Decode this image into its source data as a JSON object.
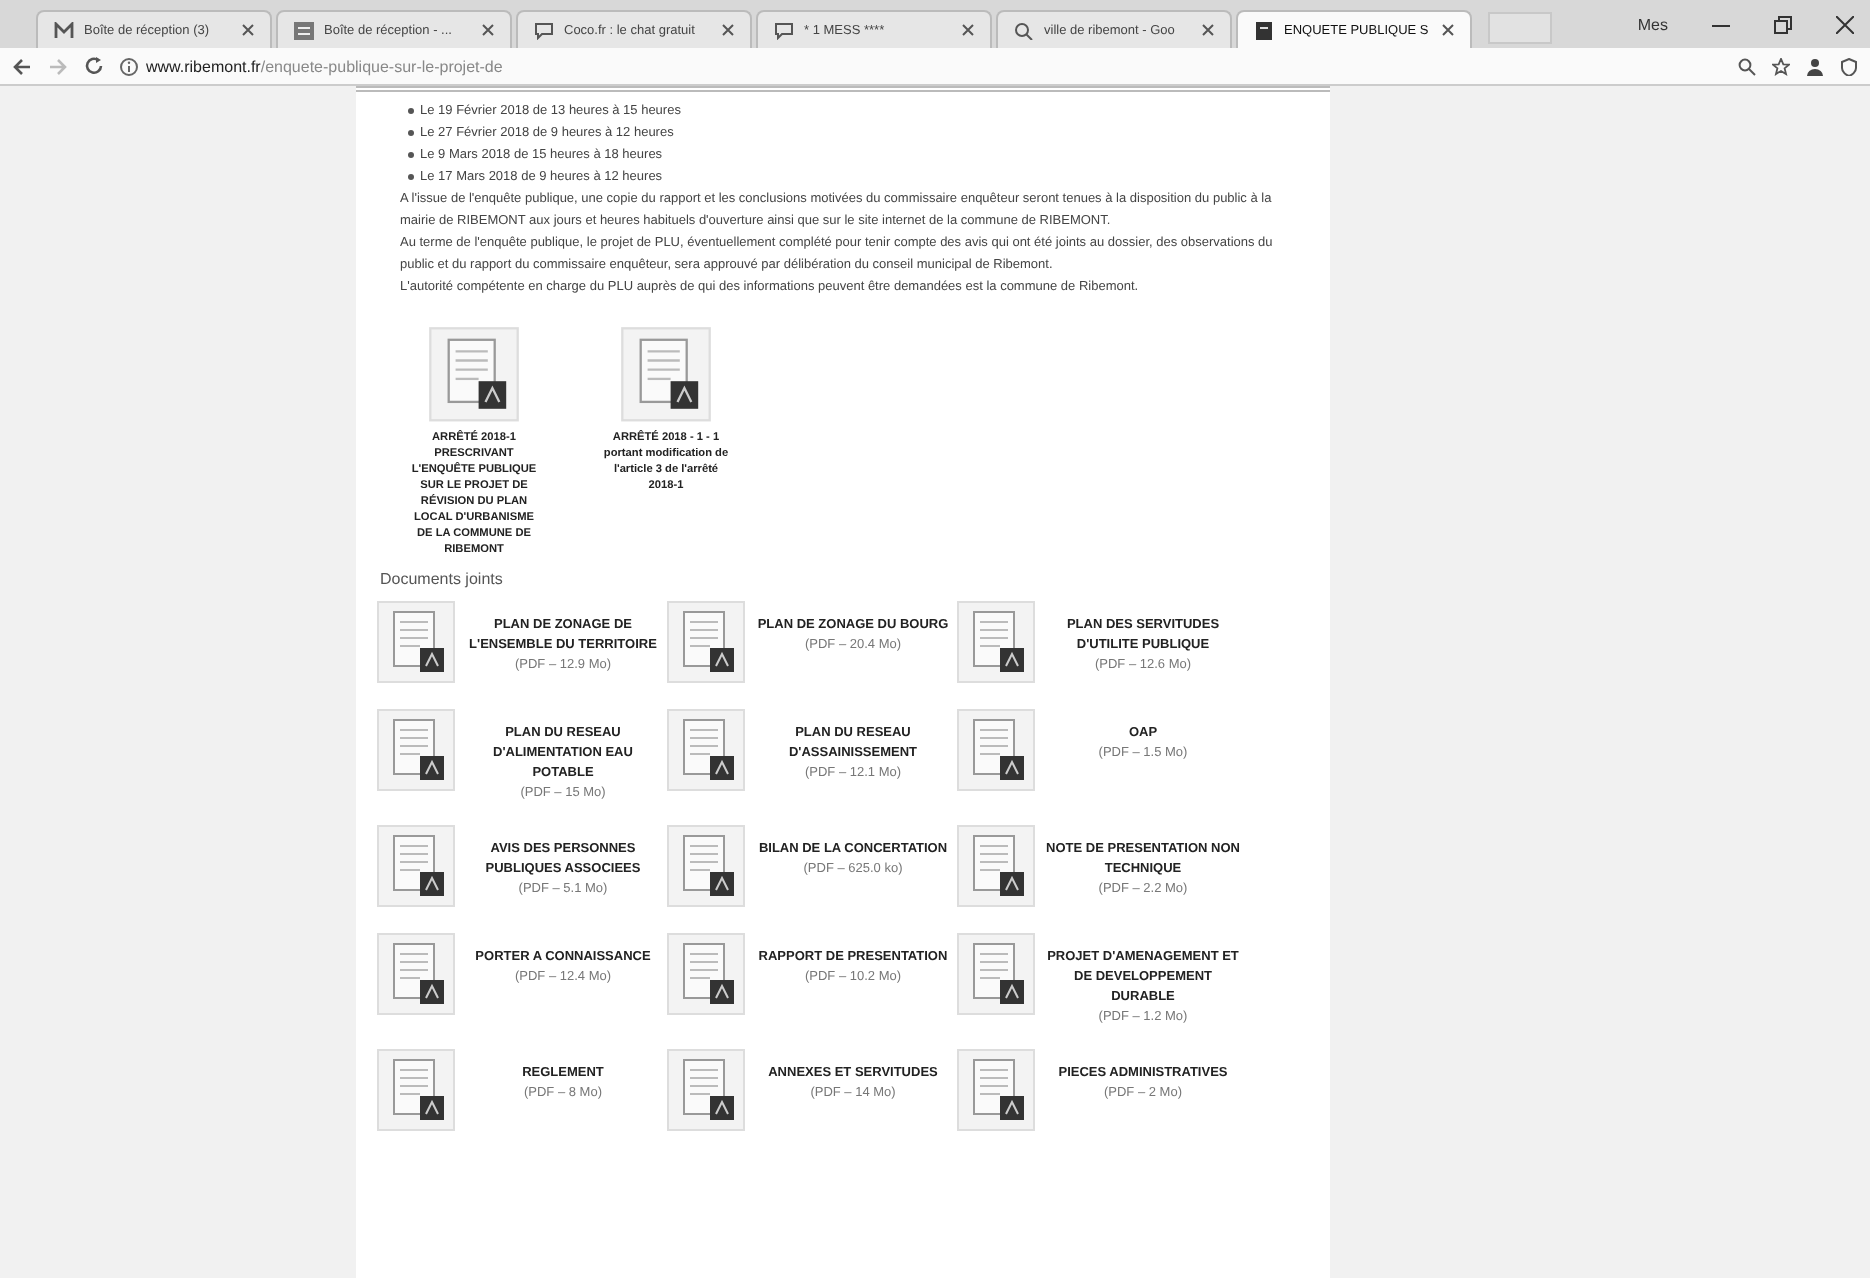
{
  "browser": {
    "tabs": [
      {
        "label": "Boîte de réception (3)",
        "kind": "mail",
        "selected": false
      },
      {
        "label": "Boîte de réception - ...",
        "kind": "inbox",
        "selected": false
      },
      {
        "label": "Coco.fr : le chat gratuit",
        "kind": "chat",
        "selected": false
      },
      {
        "label": "* 1 MESS ****",
        "kind": "chat",
        "selected": false
      },
      {
        "label": "ville de ribemont - Goo",
        "kind": "search",
        "selected": false
      },
      {
        "label": "ENQUETE PUBLIQUE S",
        "kind": "page",
        "selected": true
      }
    ],
    "profile": "Mes",
    "address": {
      "host": "www.ribemont.fr",
      "path": "/enquete-publique-sur-le-projet-de"
    }
  },
  "page": {
    "schedule": [
      "Le 19 Février 2018 de 13 heures à 15 heures",
      "Le 27 Février 2018 de 9 heures à 12 heures",
      "Le 9 Mars 2018 de 15 heures à 18 heures",
      "Le 17 Mars 2018 de 9 heures à 12 heures"
    ],
    "paragraphs": [
      "A l'issue de l'enquête publique, une copie du rapport et les conclusions motivées du commissaire enquêteur seront tenues à la disposition du public à la mairie de RIBEMONT aux jours et heures habituels d'ouverture ainsi que sur le site internet de la commune de RIBEMONT.",
      "Au terme de l'enquête publique, le projet de PLU, éventuellement complété pour tenir compte des avis qui ont été joints au dossier, des observations du public et du rapport du commissaire enquêteur, sera approuvé par délibération du conseil municipal de Ribemont.",
      "L'autorité compétente en charge du PLU auprès de qui des informations peuvent être demandées est la commune de Ribemont."
    ],
    "decrees": [
      {
        "title": "ARRÊTÉ 2018-1 PRESCRIVANT L'ENQUÊTE PUBLIQUE SUR LE PROJET DE RÉVISION DU PLAN LOCAL D'URBANISME DE LA COMMUNE DE RIBEMONT"
      },
      {
        "title": "ARRÊTÉ 2018 - 1 - 1 portant modification de l'article 3 de l'arrêté 2018-1"
      }
    ],
    "attachments_heading": "Documents joints",
    "documents": [
      {
        "title": "PLAN DE ZONAGE DE L'ENSEMBLE DU TERRITOIRE",
        "size": "(PDF – 12.9 Mo)"
      },
      {
        "title": "PLAN DE ZONAGE DU BOURG",
        "size": "(PDF – 20.4 Mo)"
      },
      {
        "title": "PLAN DES SERVITUDES D'UTILITE PUBLIQUE",
        "size": "(PDF – 12.6 Mo)"
      },
      {
        "title": "PLAN DU RESEAU D'ALIMENTATION EAU POTABLE",
        "size": "(PDF – 15 Mo)"
      },
      {
        "title": "PLAN DU RESEAU D'ASSAINISSEMENT",
        "size": "(PDF – 12.1 Mo)"
      },
      {
        "title": "OAP",
        "size": "(PDF – 1.5 Mo)"
      },
      {
        "title": "AVIS DES PERSONNES PUBLIQUES ASSOCIEES",
        "size": "(PDF – 5.1 Mo)"
      },
      {
        "title": "BILAN DE LA CONCERTATION",
        "size": "(PDF – 625.0 ko)"
      },
      {
        "title": "NOTE DE PRESENTATION NON TECHNIQUE",
        "size": "(PDF – 2.2 Mo)"
      },
      {
        "title": "PORTER A CONNAISSANCE",
        "size": "(PDF – 12.4 Mo)"
      },
      {
        "title": "RAPPORT DE PRESENTATION",
        "size": "(PDF – 10.2 Mo)"
      },
      {
        "title": "PROJET D'AMENAGEMENT ET DE DEVELOPPEMENT DURABLE",
        "size": "(PDF – 1.2 Mo)"
      },
      {
        "title": "REGLEMENT",
        "size": "(PDF – 8 Mo)"
      },
      {
        "title": "ANNEXES ET SERVITUDES",
        "size": "(PDF – 14 Mo)"
      },
      {
        "title": "PIECES ADMINISTRATIVES",
        "size": "(PDF – 2 Mo)"
      }
    ]
  }
}
